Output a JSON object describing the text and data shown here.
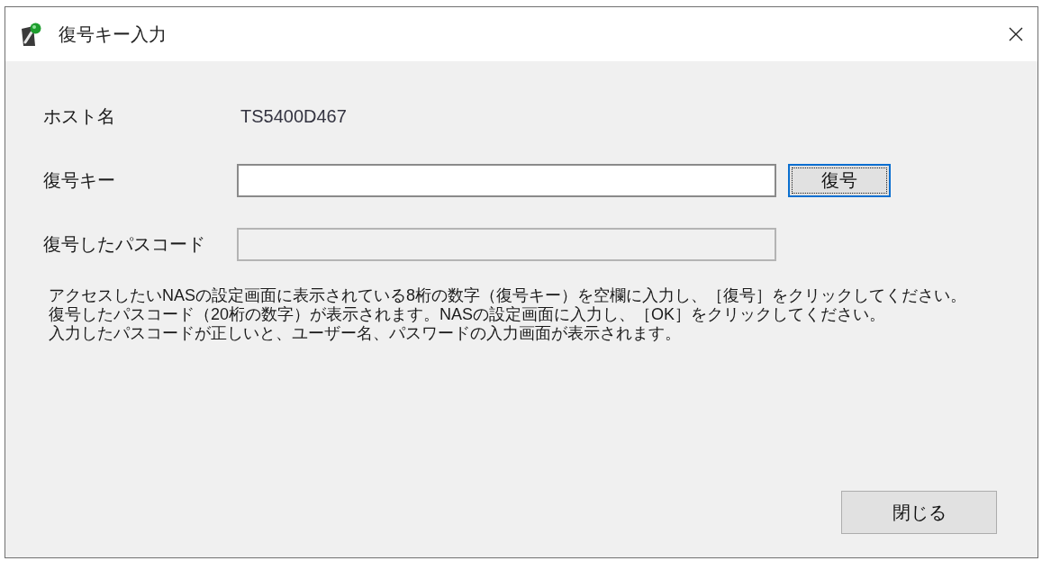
{
  "window": {
    "title": "復号キー入力"
  },
  "fields": [
    {
      "kind": "text",
      "label": "ホスト名",
      "value": "TS5400D467"
    },
    {
      "kind": "input",
      "label": "復号キー",
      "disabled": false,
      "button": {
        "label": "復号",
        "focused": true
      }
    },
    {
      "kind": "input",
      "label": "復号したパスコード",
      "disabled": true
    }
  ],
  "instructions": [
    "アクセスしたいNASの設定画面に表示されている8桁の数字（復号キー）を空欄に入力し、［復号］をクリックしてください。",
    "復号したパスコード（20桁の数字）が表示されます。NASの設定画面に入力し、［OK］をクリックしてください。",
    "入力したパスコードが正しいと、ユーザー名、パスワードの入力画面が表示されます。"
  ],
  "buttons": [
    {
      "label": "閉じる"
    }
  ]
}
